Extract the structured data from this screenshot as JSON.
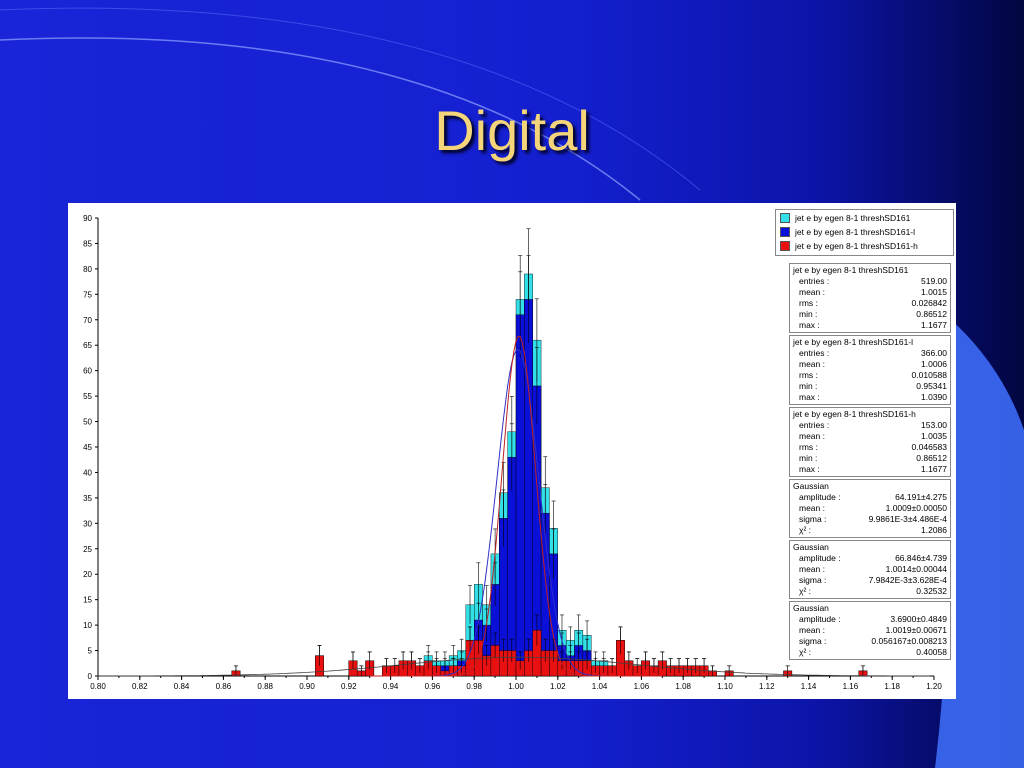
{
  "slide": {
    "title": "Digital"
  },
  "colors": {
    "background": "#1420d0",
    "title": "#f5d57a",
    "series_total": "#33e0e8",
    "series_l": "#0a10d8",
    "series_h": "#e81010",
    "fit_curve_1": "#3030c8",
    "fit_curve_2": "#c02020"
  },
  "legend": [
    {
      "label": "jet e by egen 8-1 threshSD161",
      "color": "#33e0e8"
    },
    {
      "label": "jet e by egen 8-1 threshSD161-l",
      "color": "#0a10d8"
    },
    {
      "label": "jet e by egen 8-1 threshSD161-h",
      "color": "#e81010"
    }
  ],
  "stats": [
    {
      "title": "jet e by egen 8-1 threshSD161",
      "rows": [
        [
          "entries :",
          "519.00"
        ],
        [
          "mean :",
          "1.0015"
        ],
        [
          "rms :",
          "0.026842"
        ],
        [
          "min :",
          "0.86512"
        ],
        [
          "max :",
          "1.1677"
        ]
      ]
    },
    {
      "title": "jet e by egen 8-1 threshSD161-l",
      "rows": [
        [
          "entries :",
          "366.00"
        ],
        [
          "mean :",
          "1.0006"
        ],
        [
          "rms :",
          "0.010588"
        ],
        [
          "min :",
          "0.95341"
        ],
        [
          "max :",
          "1.0390"
        ]
      ]
    },
    {
      "title": "jet e by egen 8-1 threshSD161-h",
      "rows": [
        [
          "entries :",
          "153.00"
        ],
        [
          "mean :",
          "1.0035"
        ],
        [
          "rms :",
          "0.046583"
        ],
        [
          "min :",
          "0.86512"
        ],
        [
          "max :",
          "1.1677"
        ]
      ]
    },
    {
      "title": "Gaussian",
      "rows": [
        [
          "amplitude :",
          "64.191±4.275"
        ],
        [
          "mean :",
          "1.0009±0.00050"
        ],
        [
          "sigma :",
          "9.9861E-3±4.486E-4"
        ],
        [
          "χ² :",
          "1.2086"
        ]
      ]
    },
    {
      "title": "Gaussian",
      "rows": [
        [
          "amplitude :",
          "66.846±4.739"
        ],
        [
          "mean :",
          "1.0014±0.00044"
        ],
        [
          "sigma :",
          "7.9842E-3±3.628E-4"
        ],
        [
          "χ² :",
          "0.32532"
        ]
      ]
    },
    {
      "title": "Gaussian",
      "rows": [
        [
          "amplitude :",
          "3.6900±0.4849"
        ],
        [
          "mean :",
          "1.0019±0.00671"
        ],
        [
          "sigma :",
          "0.056167±0.008213"
        ],
        [
          "χ² :",
          "0.40058"
        ]
      ]
    }
  ],
  "chart_data": {
    "type": "bar",
    "subtype": "overlaid histograms with gaussian fits",
    "xlim": [
      0.8,
      1.2
    ],
    "ylim": [
      0,
      90
    ],
    "bin_width": 0.004,
    "x_ticks": [
      "0.80",
      "0.82",
      "0.84",
      "0.86",
      "0.88",
      "0.90",
      "0.92",
      "0.94",
      "0.96",
      "0.98",
      "1.00",
      "1.02",
      "1.04",
      "1.06",
      "1.08",
      "1.10",
      "1.12",
      "1.14",
      "1.16",
      "1.18",
      "1.20"
    ],
    "y_ticks": [
      "0",
      "5",
      "10",
      "15",
      "20",
      "25",
      "30",
      "35",
      "40",
      "45",
      "50",
      "55",
      "60",
      "65",
      "70",
      "75",
      "80",
      "85",
      "90"
    ],
    "series": [
      {
        "name": "jet e by egen 8-1 threshSD161",
        "bins": [
          [
            0.864,
            1
          ],
          [
            0.904,
            4
          ],
          [
            0.92,
            3
          ],
          [
            0.924,
            1
          ],
          [
            0.928,
            3
          ],
          [
            0.936,
            2
          ],
          [
            0.94,
            2
          ],
          [
            0.944,
            3
          ],
          [
            0.948,
            3
          ],
          [
            0.952,
            2
          ],
          [
            0.956,
            4
          ],
          [
            0.96,
            3
          ],
          [
            0.964,
            3
          ],
          [
            0.968,
            4
          ],
          [
            0.972,
            5
          ],
          [
            0.976,
            14
          ],
          [
            0.98,
            18
          ],
          [
            0.984,
            14
          ],
          [
            0.988,
            24
          ],
          [
            0.992,
            36
          ],
          [
            0.996,
            48
          ],
          [
            1.0,
            74
          ],
          [
            1.004,
            79
          ],
          [
            1.008,
            66
          ],
          [
            1.012,
            37
          ],
          [
            1.016,
            29
          ],
          [
            1.02,
            9
          ],
          [
            1.024,
            7
          ],
          [
            1.028,
            9
          ],
          [
            1.032,
            8
          ],
          [
            1.036,
            3
          ],
          [
            1.04,
            3
          ],
          [
            1.044,
            2
          ],
          [
            1.048,
            7
          ],
          [
            1.052,
            3
          ],
          [
            1.056,
            2
          ],
          [
            1.06,
            3
          ],
          [
            1.064,
            2
          ],
          [
            1.068,
            3
          ],
          [
            1.072,
            2
          ],
          [
            1.076,
            2
          ],
          [
            1.08,
            2
          ],
          [
            1.084,
            2
          ],
          [
            1.088,
            2
          ],
          [
            1.092,
            1
          ],
          [
            1.1,
            1
          ],
          [
            1.128,
            1
          ],
          [
            1.164,
            1
          ]
        ]
      },
      {
        "name": "jet e by egen 8-1 threshSD161-l",
        "bins": [
          [
            0.956,
            1
          ],
          [
            0.96,
            1
          ],
          [
            0.964,
            2
          ],
          [
            0.968,
            2
          ],
          [
            0.972,
            3
          ],
          [
            0.976,
            7
          ],
          [
            0.98,
            11
          ],
          [
            0.984,
            10
          ],
          [
            0.988,
            18
          ],
          [
            0.992,
            31
          ],
          [
            0.996,
            43
          ],
          [
            1.0,
            71
          ],
          [
            1.004,
            74
          ],
          [
            1.008,
            57
          ],
          [
            1.012,
            32
          ],
          [
            1.016,
            24
          ],
          [
            1.02,
            6
          ],
          [
            1.024,
            4
          ],
          [
            1.028,
            6
          ],
          [
            1.032,
            5
          ],
          [
            1.036,
            1
          ]
        ]
      },
      {
        "name": "jet e by egen 8-1 threshSD161-h",
        "bins": [
          [
            0.864,
            1
          ],
          [
            0.904,
            4
          ],
          [
            0.92,
            3
          ],
          [
            0.924,
            1
          ],
          [
            0.928,
            3
          ],
          [
            0.936,
            2
          ],
          [
            0.94,
            2
          ],
          [
            0.944,
            3
          ],
          [
            0.948,
            3
          ],
          [
            0.952,
            2
          ],
          [
            0.956,
            3
          ],
          [
            0.96,
            2
          ],
          [
            0.964,
            1
          ],
          [
            0.968,
            2
          ],
          [
            0.972,
            2
          ],
          [
            0.976,
            7
          ],
          [
            0.98,
            7
          ],
          [
            0.984,
            4
          ],
          [
            0.988,
            6
          ],
          [
            0.992,
            5
          ],
          [
            0.996,
            5
          ],
          [
            1.0,
            3
          ],
          [
            1.004,
            5
          ],
          [
            1.008,
            9
          ],
          [
            1.012,
            5
          ],
          [
            1.016,
            5
          ],
          [
            1.02,
            3
          ],
          [
            1.024,
            3
          ],
          [
            1.028,
            3
          ],
          [
            1.032,
            3
          ],
          [
            1.036,
            2
          ],
          [
            1.04,
            2
          ],
          [
            1.044,
            2
          ],
          [
            1.048,
            7
          ],
          [
            1.052,
            3
          ],
          [
            1.056,
            2
          ],
          [
            1.06,
            3
          ],
          [
            1.064,
            2
          ],
          [
            1.068,
            3
          ],
          [
            1.072,
            2
          ],
          [
            1.076,
            2
          ],
          [
            1.08,
            2
          ],
          [
            1.084,
            2
          ],
          [
            1.088,
            2
          ],
          [
            1.092,
            1
          ],
          [
            1.1,
            1
          ],
          [
            1.128,
            1
          ],
          [
            1.164,
            1
          ]
        ]
      }
    ],
    "fits": [
      {
        "amplitude": 64.191,
        "mean": 1.0009,
        "sigma": 0.0099861,
        "color": "#3030c8"
      },
      {
        "amplitude": 66.846,
        "mean": 1.0014,
        "sigma": 0.0079842,
        "color": "#c02020"
      }
    ]
  }
}
